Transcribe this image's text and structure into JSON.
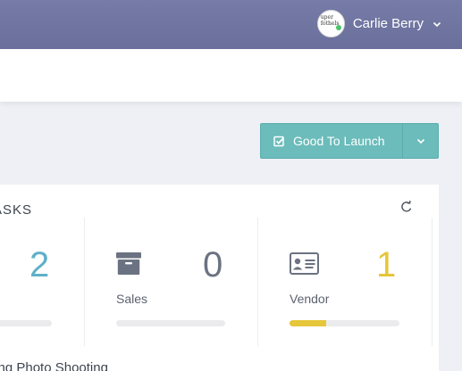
{
  "header": {
    "user_name": "Carlie Berry",
    "avatar_text": [
      "uper",
      "fothels"
    ]
  },
  "actions": {
    "launch_label": "Good To Launch"
  },
  "tasks": {
    "title": "ASKS",
    "stats": [
      {
        "label": "",
        "count": "2",
        "progress": 0.15,
        "color": "#5fb0c9"
      },
      {
        "label": "Sales",
        "count": "0",
        "progress": 0.0,
        "color": "#6b7281"
      },
      {
        "label": "Vendor",
        "count": "1",
        "progress": 0.33,
        "color": "#e6c63a"
      }
    ],
    "footer": "ting Photo Shooting"
  },
  "icons": [
    "user-caret-icon",
    "check-square-icon",
    "chevron-down-icon",
    "refresh-icon",
    "archive-box-icon",
    "id-card-icon"
  ]
}
